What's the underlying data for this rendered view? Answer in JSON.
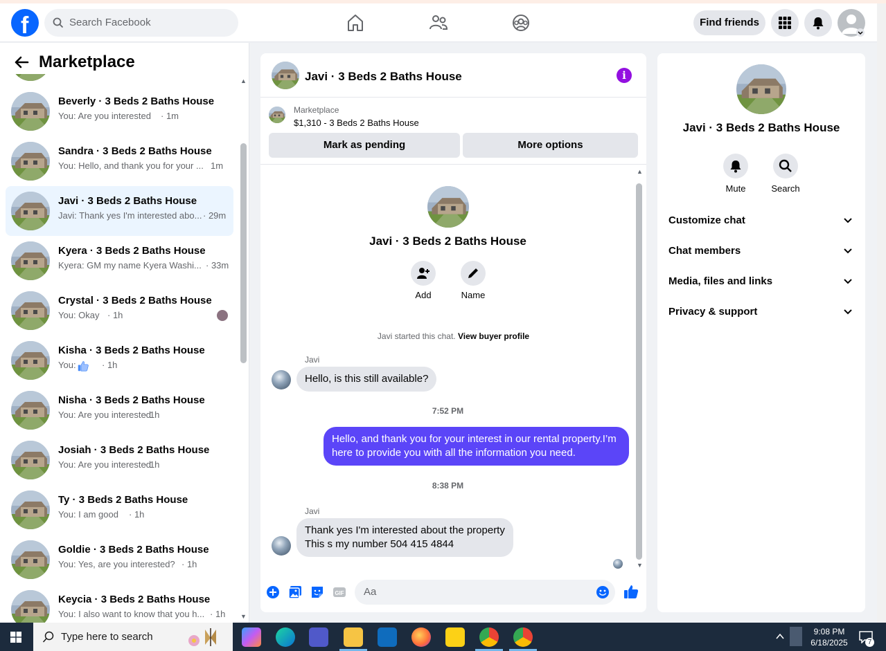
{
  "header": {
    "search_placeholder": "Search Facebook",
    "find_friends_label": "Find friends"
  },
  "left_panel": {
    "title": "Marketplace",
    "conversations": [
      {
        "name": "Beverly · 3 Beds 2 Baths House",
        "preview": "You: Are you interested",
        "time": "· 1m",
        "active": false
      },
      {
        "name": "Sandra · 3 Beds 2 Baths House",
        "preview": "You: Hello, and thank you for your ...",
        "time": "1m",
        "active": false
      },
      {
        "name": "Javi · 3 Beds 2 Baths House",
        "preview": "Javi: Thank yes I'm interested abo...",
        "time": "· 29m",
        "active": true
      },
      {
        "name": "Kyera · 3 Beds 2 Baths House",
        "preview": "Kyera: GM my name Kyera Washi...",
        "time": "· 33m",
        "active": false
      },
      {
        "name": "Crystal · 3 Beds 2 Baths House",
        "preview": "You: Okay",
        "time": "· 1h",
        "active": false
      },
      {
        "name": "Kisha · 3 Beds 2 Baths House",
        "preview": "You:",
        "time": "· 1h",
        "active": false
      },
      {
        "name": "Nisha · 3 Beds 2 Baths House",
        "preview": "You: Are you interested",
        "time": "· 1h",
        "active": false
      },
      {
        "name": "Josiah · 3 Beds 2 Baths House",
        "preview": "You: Are you interested",
        "time": "· 1h",
        "active": false
      },
      {
        "name": "Ty · 3 Beds 2 Baths House",
        "preview": "You: I am good",
        "time": "· 1h",
        "active": false
      },
      {
        "name": "Goldie · 3 Beds 2 Baths House",
        "preview": "You: Yes, are you interested?",
        "time": "· 1h",
        "active": false
      },
      {
        "name": "Keycia · 3 Beds 2 Baths House",
        "preview": "You: I also want to know that you h...",
        "time": "· 1h",
        "active": false
      }
    ]
  },
  "chat": {
    "title": "Javi · 3 Beds 2 Baths House",
    "listing_source": "Marketplace",
    "listing_price": "$1,310 - 3 Beds 2 Baths House",
    "mark_pending_label": "Mark as pending",
    "more_options_label": "More options",
    "add_label": "Add",
    "name_label": "Name",
    "started_text": "Javi started this chat.",
    "view_buyer_profile": "View buyer profile",
    "messages": [
      {
        "sender": "Javi",
        "text": "Hello, is this still available?"
      },
      {
        "timestamp": "7:52 PM"
      },
      {
        "text": "Hello, and thank you for your interest in our rental property.I’m here to provide you with all the information you need."
      },
      {
        "timestamp": "8:38 PM"
      },
      {
        "sender": "Javi",
        "line1": "Thank  yes I'm interested about the property",
        "line2": "This s my number 504 415 4844"
      }
    ],
    "composer_placeholder": "Aa"
  },
  "right_panel": {
    "title": "Javi · 3 Beds 2 Baths House",
    "mute_label": "Mute",
    "search_label": "Search",
    "sections": [
      "Customize chat",
      "Chat members",
      "Media, files and links",
      "Privacy & support"
    ]
  },
  "taskbar": {
    "search_placeholder": "Type here to search",
    "time": "9:08 PM",
    "date": "6/18/2025",
    "notification_count": "7"
  }
}
